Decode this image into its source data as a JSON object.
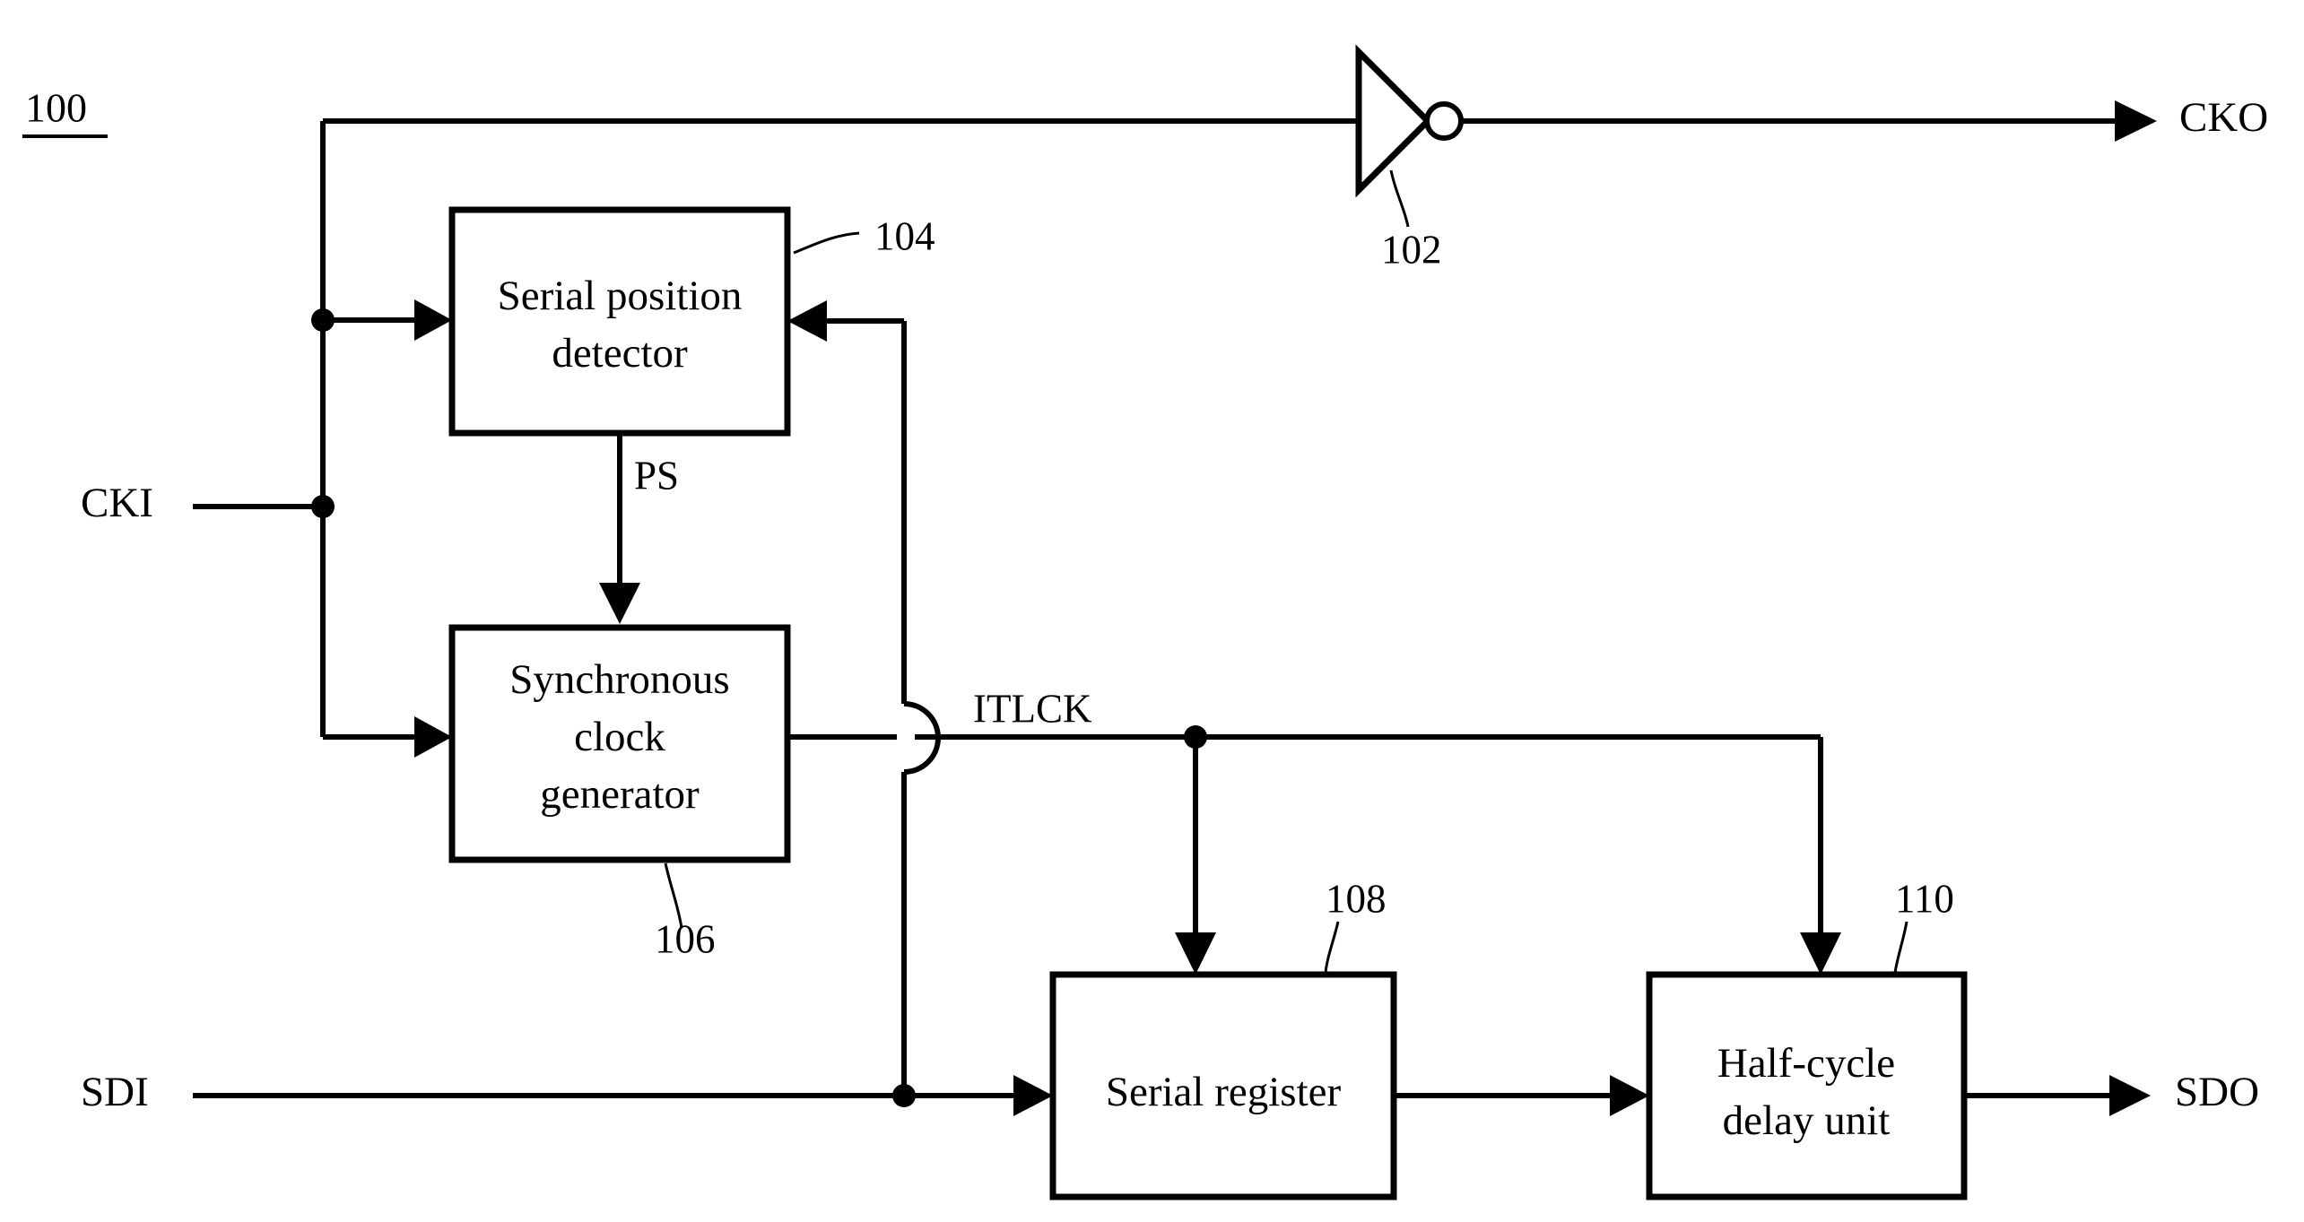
{
  "figure": {
    "number": "100",
    "type": "patent-block-diagram"
  },
  "blocks": [
    {
      "id": "serial-position-detector",
      "label_line1": "Serial position",
      "label_line2": "detector",
      "ref": "104"
    },
    {
      "id": "synchronous-clock-generator",
      "label_line1": "Synchronous",
      "label_line2": "clock",
      "label_line3": "generator",
      "ref": "106"
    },
    {
      "id": "serial-register",
      "label_line1": "Serial register",
      "ref": "108"
    },
    {
      "id": "half-cycle-delay-unit",
      "label_line1": "Half-cycle",
      "label_line2": "delay unit",
      "ref": "110"
    }
  ],
  "gates": [
    {
      "id": "inverter",
      "kind": "inverter",
      "ref": "102"
    }
  ],
  "ports": {
    "cki": "CKI",
    "sdi": "SDI",
    "cko": "CKO",
    "sdo": "SDO"
  },
  "signals": {
    "ps": "PS",
    "itlck": "ITLCK"
  },
  "colors": {
    "line": "#000000",
    "fill": "#ffffff",
    "background": "#ffffff"
  }
}
